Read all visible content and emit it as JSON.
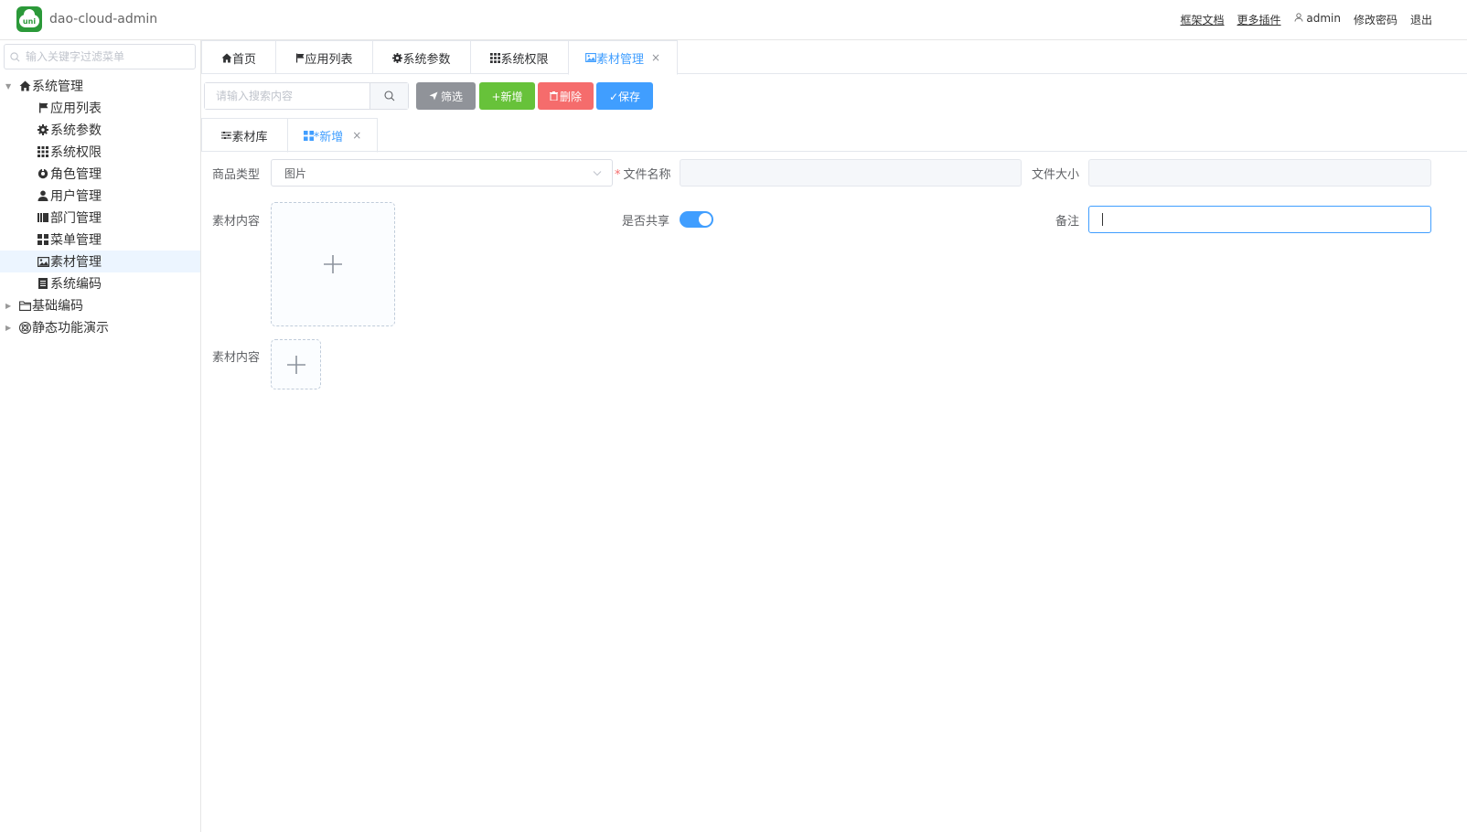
{
  "header": {
    "app_title": "dao-cloud-admin",
    "logo_text": "uni",
    "links": {
      "docs": "框架文档",
      "plugins": "更多插件",
      "user": "admin",
      "change_password": "修改密码",
      "logout": "退出"
    }
  },
  "sidebar": {
    "search_placeholder": "输入关键字过滤菜单",
    "items": [
      {
        "label": "系统管理",
        "icon": "home-icon",
        "expanded": true
      },
      {
        "label": "应用列表",
        "icon": "flag-icon"
      },
      {
        "label": "系统参数",
        "icon": "gear-icon"
      },
      {
        "label": "系统权限",
        "icon": "grid-icon"
      },
      {
        "label": "角色管理",
        "icon": "role-icon"
      },
      {
        "label": "用户管理",
        "icon": "user-icon"
      },
      {
        "label": "部门管理",
        "icon": "department-icon"
      },
      {
        "label": "菜单管理",
        "icon": "menu-grid-icon"
      },
      {
        "label": "素材管理",
        "icon": "image-icon",
        "active": true
      },
      {
        "label": "系统编码",
        "icon": "doc-icon"
      },
      {
        "label": "基础编码",
        "icon": "folder-icon",
        "expanded": false
      },
      {
        "label": "静态功能演示",
        "icon": "atom-icon",
        "expanded": false
      }
    ]
  },
  "main_tabs": [
    {
      "label": "首页",
      "icon": "home-icon"
    },
    {
      "label": "应用列表",
      "icon": "flag-icon"
    },
    {
      "label": "系统参数",
      "icon": "gear-icon"
    },
    {
      "label": "系统权限",
      "icon": "grid-icon"
    },
    {
      "label": "素材管理",
      "icon": "image-icon",
      "active": true,
      "close": "×"
    }
  ],
  "toolbar": {
    "search_placeholder": "请输入搜索内容",
    "filter_label": "筛选",
    "add_label": "+新增",
    "delete_label": "删除",
    "save_label": "✓保存"
  },
  "sub_tabs": [
    {
      "label": "素材库",
      "icon": "sliders-icon"
    },
    {
      "label": "*新增",
      "icon": "grid-icon",
      "active": true,
      "close": "×"
    }
  ],
  "form": {
    "product_type_label": "商品类型",
    "product_type_value": "图片",
    "file_name_label": "文件名称",
    "file_size_label": "文件大小",
    "content_label_1": "素材内容",
    "share_label": "是否共享",
    "share_value": true,
    "remark_label": "备注",
    "content_label_2": "素材内容"
  },
  "colors": {
    "primary": "#409eff",
    "success": "#67c23a",
    "danger": "#f56c6c",
    "info": "#909399",
    "logo": "#2b9939"
  }
}
